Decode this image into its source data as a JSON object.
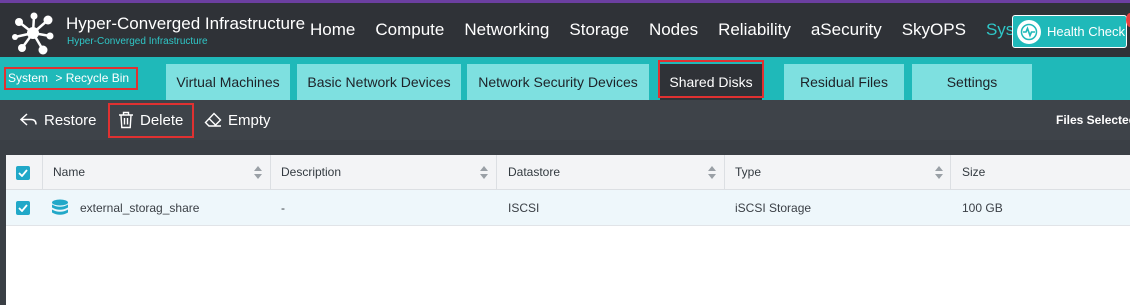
{
  "app": {
    "title": "Hyper-Converged Infrastructure",
    "subtitle": "Hyper-Converged Infrastructure"
  },
  "nav": {
    "items": [
      {
        "label": "Home"
      },
      {
        "label": "Compute"
      },
      {
        "label": "Networking"
      },
      {
        "label": "Storage"
      },
      {
        "label": "Nodes"
      },
      {
        "label": "Reliability"
      },
      {
        "label": "aSecurity"
      },
      {
        "label": "SkyOPS"
      },
      {
        "label": "System",
        "active": true
      }
    ],
    "health_check": "Health Check"
  },
  "breadcrumb": {
    "root": "System",
    "separator": ">",
    "current": "Recycle Bin"
  },
  "tabs": [
    {
      "label": "Virtual Machines"
    },
    {
      "label": "Basic Network Devices"
    },
    {
      "label": "Network Security Devices"
    },
    {
      "label": "Shared Disks",
      "active": true
    },
    {
      "label": "Residual Files"
    },
    {
      "label": "Settings"
    }
  ],
  "toolbar": {
    "restore": "Restore",
    "delete": "Delete",
    "empty": "Empty",
    "files_selected": "Files Selected"
  },
  "table": {
    "columns": [
      "Name",
      "Description",
      "Datastore",
      "Type",
      "Size"
    ],
    "rows": [
      {
        "selected": true,
        "icon": "disk-icon",
        "name": "external_storag_share",
        "description": "-",
        "datastore": "ISCSI",
        "type": "iSCSI Storage",
        "size": "100 GB"
      }
    ]
  },
  "colors": {
    "accent": "#1fb9b9",
    "topbar": "#2f3237",
    "highlight": "#e03131",
    "checkbox": "#21a8c8"
  }
}
